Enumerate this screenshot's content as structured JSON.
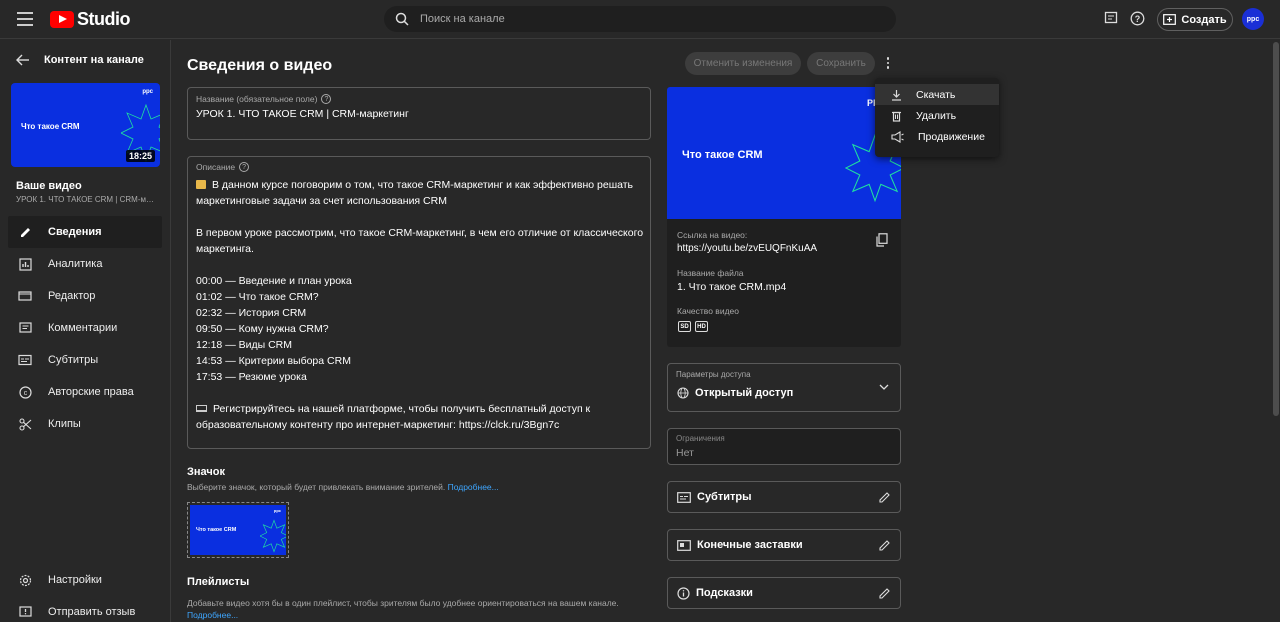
{
  "app": {
    "brand": "Studio",
    "search_placeholder": "Поиск на канале",
    "create_label": "Создать",
    "avatar_text": "ppc"
  },
  "colors": {
    "brand_red": "#ff0000",
    "thumb_blue": "#0a2fe0",
    "link": "#3ea6ff",
    "accent_green": "#1fe0a0"
  },
  "sidebar": {
    "back_label": "Контент на канале",
    "thumb_title": "Что такое CRM",
    "thumb_logo": "ppc",
    "duration": "18:25",
    "your_video_label": "Ваше видео",
    "your_video_title": "УРОК 1. ЧТО ТАКОЕ CRM | CRM-маркетинг",
    "nav": [
      {
        "label": "Сведения",
        "icon": "pencil-icon",
        "active": true
      },
      {
        "label": "Аналитика",
        "icon": "analytics-icon",
        "active": false
      },
      {
        "label": "Редактор",
        "icon": "editor-icon",
        "active": false
      },
      {
        "label": "Комментарии",
        "icon": "comments-icon",
        "active": false
      },
      {
        "label": "Субтитры",
        "icon": "subtitles-icon",
        "active": false
      },
      {
        "label": "Авторские права",
        "icon": "copyright-icon",
        "active": false
      },
      {
        "label": "Клипы",
        "icon": "scissors-icon",
        "active": false
      }
    ],
    "bottom": [
      {
        "label": "Настройки",
        "icon": "gear-icon"
      },
      {
        "label": "Отправить отзыв",
        "icon": "feedback-icon"
      }
    ]
  },
  "main": {
    "title": "Сведения о видео",
    "undo_label": "Отменить изменения",
    "save_label": "Сохранить",
    "title_field": {
      "label": "Название (обязательное поле)",
      "value": "УРОК 1. ЧТО ТАКОЕ CRM | CRM-маркетинг"
    },
    "description_field": {
      "label": "Описание",
      "lines": [
        "В данном курсе поговорим о том, что такое CRM-маркетинг и как эффективно решать",
        "маркетинговые задачи за счет использования CRM",
        "",
        "В первом уроке рассмотрим, что такое CRM-маркетинг, в чем его отличие от классического",
        "маркетинга.",
        "",
        "00:00 — Введение и план урока",
        "01:02 — Что такое CRM?",
        "02:32 — История CRM",
        "09:50 — Кому нужна CRM?",
        "12:18 — Виды CRM",
        "14:53 — Критерии выбора CRM",
        "17:53 — Резюме урока",
        "",
        "Регистрируйтесь на нашей платформе, чтобы получить бесплатный доступ к",
        "образовательному контенту про интернет-маркетинг: https://clck.ru/3Bgn7c"
      ]
    },
    "thumbnail": {
      "heading": "Значок",
      "hint": "Выберите значок, который будет привлекать внимание зрителей.",
      "more": "Подробнее...",
      "thumb_title": "Что такое CRM",
      "thumb_logo": "ppc"
    },
    "playlists": {
      "heading": "Плейлисты",
      "hint": "Добавьте видео хотя бы в один плейлист, чтобы зрителям было удобнее ориентироваться на вашем канале.",
      "more": "Подробнее..."
    }
  },
  "right": {
    "preview_title": "Что такое CRM",
    "preview_logo": "PP",
    "link_label": "Ссылка на видео:",
    "link_value": "https://youtu.be/zvEUQFnKuAA",
    "filename_label": "Название файла",
    "filename_value": "1. Что такое CRM.mp4",
    "quality_label": "Качество видео",
    "quality_badges": [
      "SD",
      "HD"
    ],
    "access": {
      "label": "Параметры доступа",
      "value": "Открытый доступ"
    },
    "restrictions": {
      "label": "Ограничения",
      "value": "Нет"
    },
    "actions": [
      {
        "label": "Субтитры",
        "icon": "subtitles-icon"
      },
      {
        "label": "Конечные заставки",
        "icon": "end-screen-icon"
      },
      {
        "label": "Подсказки",
        "icon": "info-icon"
      }
    ]
  },
  "dropdown": {
    "items": [
      {
        "label": "Скачать",
        "icon": "download-icon"
      },
      {
        "label": "Удалить",
        "icon": "trash-icon"
      },
      {
        "label": "Продвижение",
        "icon": "megaphone-icon"
      }
    ]
  }
}
